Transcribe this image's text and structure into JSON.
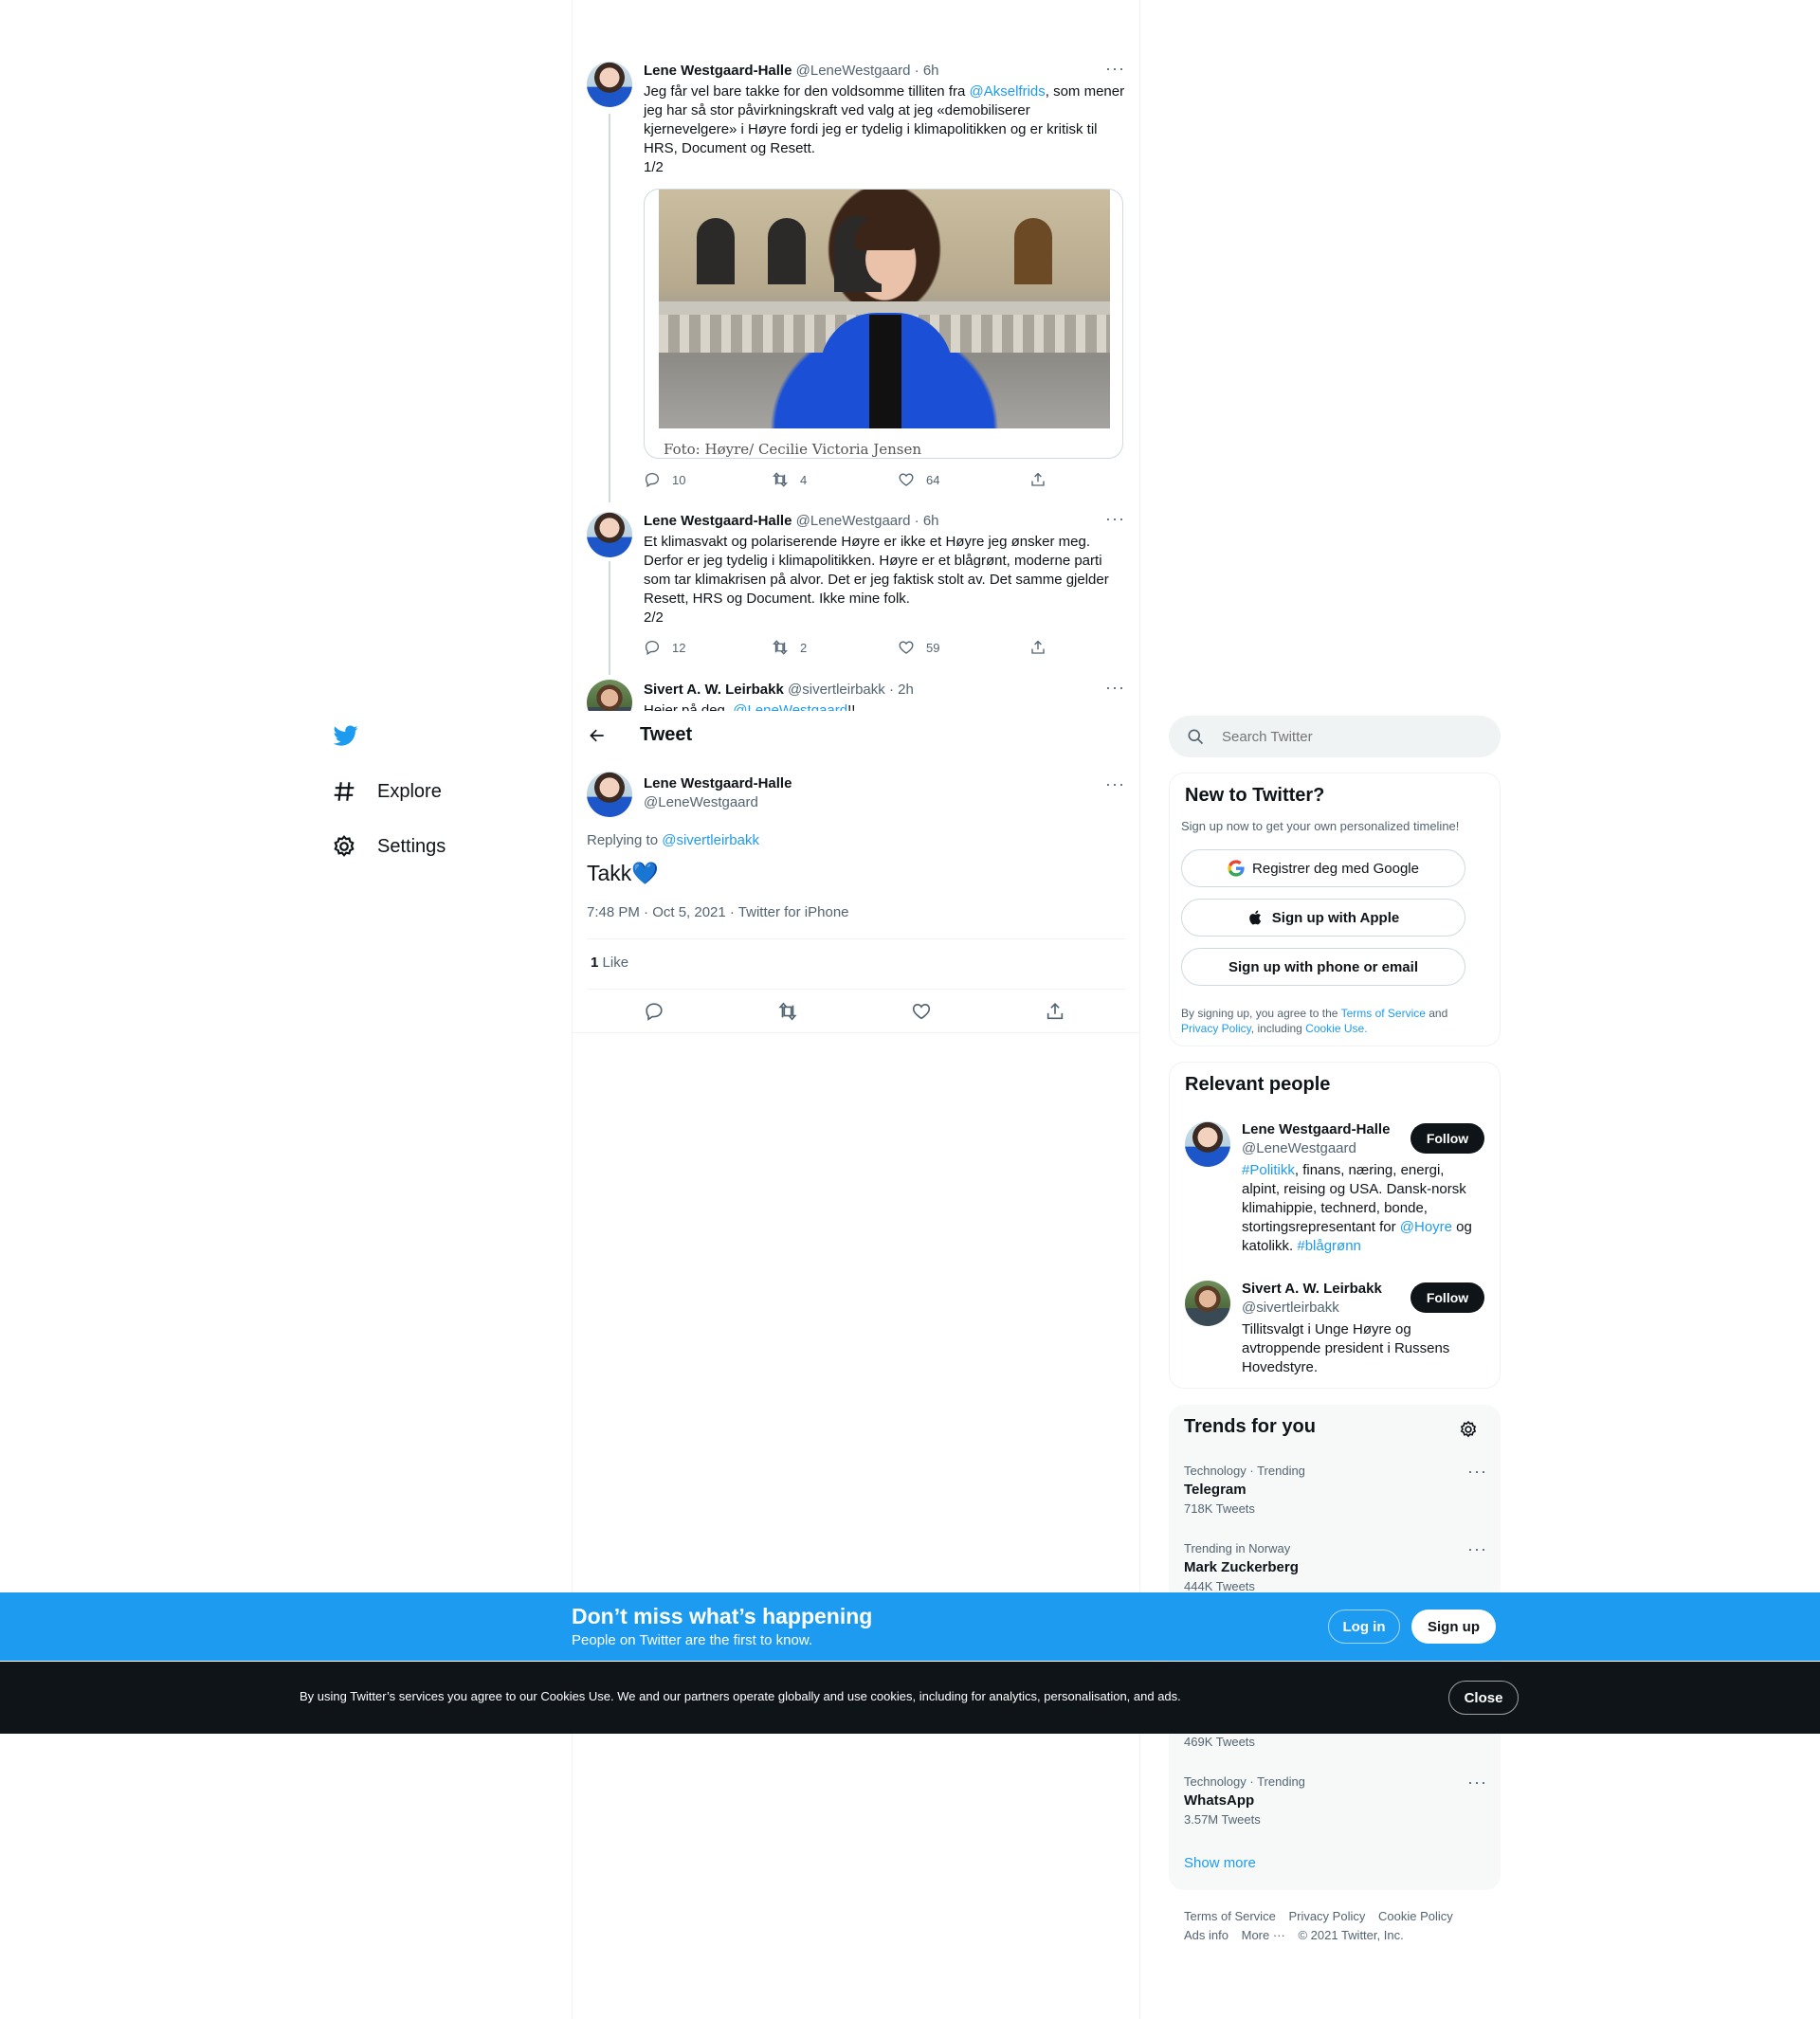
{
  "nav": {
    "explore": "Explore",
    "settings": "Settings"
  },
  "thread": [
    {
      "name": "Lene Westgaard-Halle",
      "handle": "@LeneWestgaard",
      "time": "· 6h",
      "text_a": "Jeg får vel bare takke for den voldsomme tilliten fra ",
      "mention": "@Akselfrids",
      "text_b": ", som mener jeg har så stor påvirkningskraft ved valg at jeg «demobiliserer kjernevelgere» i Høyre fordi jeg er tydelig i klimapolitikken og er kritisk til HRS, Document og Resett.",
      "text_c": "1/2",
      "media_caption": "Foto: Høyre/ Cecilie Victoria Jensen",
      "replies": "10",
      "retweets": "4",
      "likes": "64"
    },
    {
      "name": "Lene Westgaard-Halle",
      "handle": "@LeneWestgaard",
      "time": "· 6h",
      "text_a": "Et klimasvakt og polariserende Høyre er ikke et Høyre jeg ønsker meg. Derfor er jeg tydelig i klimapolitikken. Høyre er et blågrønt, moderne parti som tar klimakrisen på alvor. Det er jeg faktisk stolt av. Det samme gjelder Resett, HRS og Document. Ikke mine folk.",
      "text_c": "2/2",
      "replies": "12",
      "retweets": "2",
      "likes": "59"
    },
    {
      "name": "Sivert A. W. Leirbakk",
      "handle": "@sivertleirbakk",
      "time": "· 2h",
      "text_a": "Heier på deg, ",
      "mention": "@LeneWestgaard",
      "text_b": "!!"
    }
  ],
  "header": {
    "title": "Tweet"
  },
  "focus": {
    "name": "Lene Westgaard-Halle",
    "handle": "@LeneWestgaard",
    "replying_label": "Replying to ",
    "replying_to": "@sivertleirbakk",
    "text": "Takk💙",
    "meta": "7:48 PM · Oct 5, 2021 · Twitter for iPhone",
    "like_count": "1",
    "like_label": "Like"
  },
  "search": {
    "placeholder": "Search Twitter"
  },
  "new_to_twitter": {
    "title": "New to Twitter?",
    "subtitle": "Sign up now to get your own personalized timeline!",
    "google": "Registrer deg med Google",
    "apple": "Sign up with Apple",
    "phone": "Sign up with phone or email",
    "legal_a": "By signing up, you agree to the ",
    "tos": "Terms of Service",
    "legal_b": " and ",
    "privacy": "Privacy Policy",
    "legal_c": ", including ",
    "cookie": "Cookie Use."
  },
  "relevant": {
    "title": "Relevant people",
    "people": [
      {
        "name": "Lene Westgaard-Halle",
        "handle": "@LeneWestgaard",
        "follow": "Follow",
        "bio_tag1": "#Politikk",
        "bio_a": ", finans, næring, energi, alpint, reising og USA. Dansk-norsk klimahippie, technerd, bonde, stortingsrepresentant for ",
        "bio_mention": "@Hoyre",
        "bio_b": " og katolikk. ",
        "bio_tag2": "#blågrønn"
      },
      {
        "name": "Sivert A. W. Leirbakk",
        "handle": "@sivertleirbakk",
        "follow": "Follow",
        "bio_a": "Tillitsvalgt i Unge Høyre og avtroppende president i Russens Hovedstyre."
      }
    ]
  },
  "trends": {
    "title": "Trends for you",
    "items": [
      {
        "category": "Technology · Trending",
        "name": "Telegram",
        "count": "718K Tweets"
      },
      {
        "category": "Trending in Norway",
        "name": "Mark Zuckerberg",
        "count": "444K Tweets"
      },
      {
        "count": "469K Tweets"
      },
      {
        "category": "Technology · Trending",
        "name": "WhatsApp",
        "count": "3.57M Tweets"
      }
    ],
    "show_more": "Show more"
  },
  "footer": {
    "tos": "Terms of Service",
    "privacy": "Privacy Policy",
    "cookie": "Cookie Policy",
    "ads": "Ads info",
    "more": "More ···",
    "copyright": "© 2021 Twitter, Inc."
  },
  "signup_bar": {
    "title": "Don’t miss what’s happening",
    "subtitle": "People on Twitter are the first to know.",
    "login": "Log in",
    "signup": "Sign up"
  },
  "cookie_bar": {
    "text": "By using Twitter’s services you agree to our Cookies Use. We and our partners operate globally and use cookies, including for analytics, personalisation, and ads.",
    "close": "Close"
  },
  "colors": {
    "accent": "#1d9bf0",
    "dark": "#0f1419",
    "muted": "#536471"
  }
}
